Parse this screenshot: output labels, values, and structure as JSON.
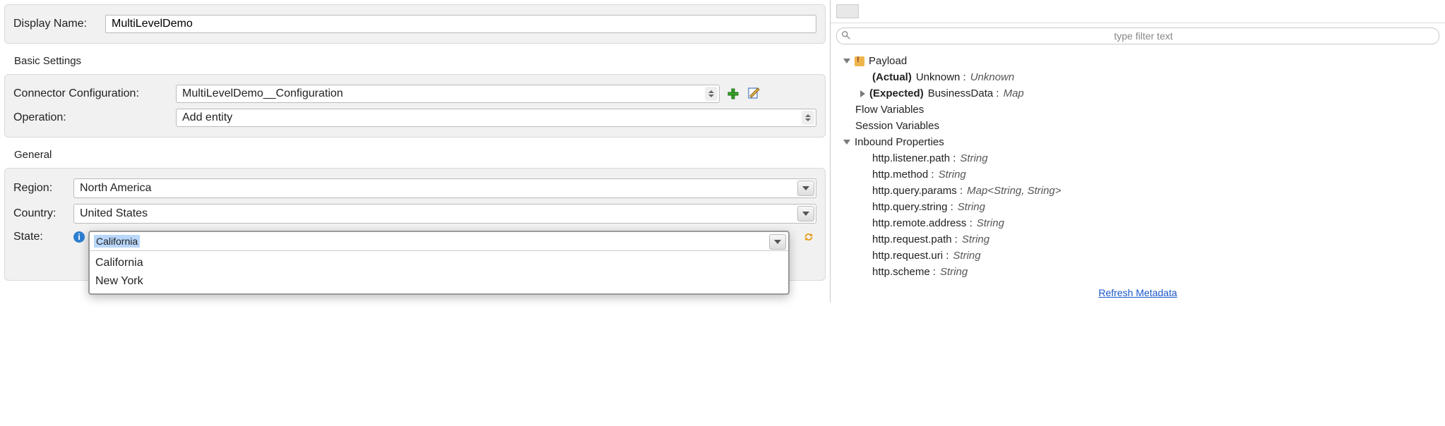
{
  "display_name": {
    "label": "Display Name:",
    "value": "MultiLevelDemo"
  },
  "basic_settings": {
    "title": "Basic Settings",
    "connector_label": "Connector Configuration:",
    "connector_value": "MultiLevelDemo__Configuration",
    "operation_label": "Operation:",
    "operation_value": "Add entity"
  },
  "general": {
    "title": "General",
    "region_label": "Region:",
    "region_value": "North America",
    "country_label": "Country:",
    "country_value": "United States",
    "state_label": "State:",
    "state_value": "California",
    "state_options": [
      "California",
      "New York"
    ]
  },
  "right": {
    "filter_placeholder": "type filter text",
    "payload_label": "Payload",
    "actual_label": "(Actual)",
    "actual_name": "Unknown :",
    "actual_type": "Unknown",
    "expected_label": "(Expected)",
    "expected_name": "BusinessData :",
    "expected_type": "Map",
    "flow_vars": "Flow Variables",
    "session_vars": "Session Variables",
    "inbound": "Inbound Properties",
    "props": [
      {
        "name": "http.listener.path :",
        "type": "String"
      },
      {
        "name": "http.method :",
        "type": "String"
      },
      {
        "name": "http.query.params :",
        "type": "Map<String, String>"
      },
      {
        "name": "http.query.string :",
        "type": "String"
      },
      {
        "name": "http.remote.address :",
        "type": "String"
      },
      {
        "name": "http.request.path :",
        "type": "String"
      },
      {
        "name": "http.request.uri :",
        "type": "String"
      },
      {
        "name": "http.scheme :",
        "type": "String"
      }
    ],
    "refresh": "Refresh Metadata"
  }
}
